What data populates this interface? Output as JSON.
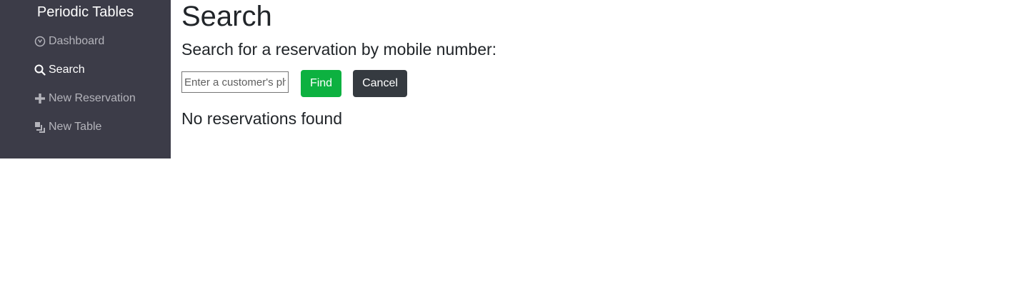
{
  "sidebar": {
    "brand": "Periodic Tables",
    "items": [
      {
        "label": "Dashboard",
        "icon": "dashboard-icon",
        "active": false
      },
      {
        "label": "Search",
        "icon": "search-icon",
        "active": true
      },
      {
        "label": "New Reservation",
        "icon": "plus-icon",
        "active": false
      },
      {
        "label": "New Table",
        "icon": "layers-icon",
        "active": false
      }
    ],
    "background_color": "#3c3c48"
  },
  "main": {
    "title": "Search",
    "subtitle": "Search for a reservation by mobile number:",
    "search": {
      "placeholder": "Enter a customer's phone number",
      "value": ""
    },
    "find_label": "Find",
    "cancel_label": "Cancel",
    "result_message": "No reservations found"
  },
  "colors": {
    "find_button": "#0db140",
    "cancel_button": "#353a40"
  }
}
